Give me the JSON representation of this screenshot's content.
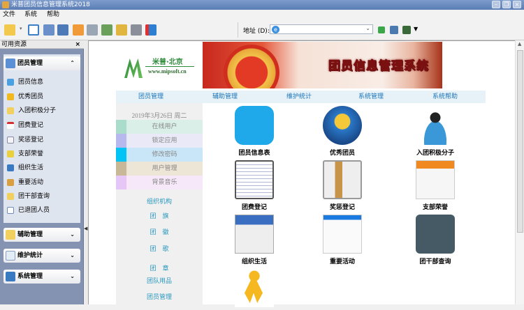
{
  "window": {
    "title": "米普团员信息管理系统2018"
  },
  "menu": [
    "文件",
    "系统",
    "帮助"
  ],
  "address": {
    "label": "地址 (D):",
    "value": ""
  },
  "left_panel": {
    "header": "可用资源",
    "close": "×",
    "groups": [
      {
        "label": "团员管理",
        "expanded": true,
        "items": [
          "团员信息",
          "优秀团员",
          "入团积极分子",
          "团费登记",
          "奖惩登记",
          "支部荣誉",
          "组织生活",
          "重要活动",
          "团干部查询",
          "已退团人员"
        ]
      },
      {
        "label": "辅助管理",
        "expanded": false
      },
      {
        "label": "维护统计",
        "expanded": false
      },
      {
        "label": "系统管理",
        "expanded": false
      }
    ]
  },
  "banner": {
    "logo_cn": "米普·北京",
    "logo_url": "www.mipsoft.cn",
    "title": "团员信息管理系统"
  },
  "nav": [
    "团员管理",
    "辅助管理",
    "维护统计",
    "系统管理",
    "系统帮助"
  ],
  "sidebar": {
    "date": "2019年3月26日  周二",
    "quick": [
      {
        "label": "在线用户",
        "color": "#a9dccb",
        "bg": "#d9efe7"
      },
      {
        "label": "锁定应用",
        "color": "#b7b9ee",
        "bg": "#e9e9f8"
      },
      {
        "label": "修改密码",
        "color": "#00c4f6",
        "bg": "#c8e6f8"
      },
      {
        "label": "用户管理",
        "color": "#c8b898",
        "bg": "#ede5d6"
      },
      {
        "label": "背景音乐",
        "color": "#e6c6f6",
        "bg": "#f6e8f8"
      }
    ],
    "links": [
      "组织机构",
      "团　旗",
      "团　徽",
      "团　歌",
      "团　章",
      "团队用品",
      "团员管理"
    ]
  },
  "apps": [
    "团员信息表",
    "优秀团员",
    "入团积极分子",
    "团费登记",
    "奖惩登记",
    "支部荣誉",
    "组织生活",
    "重要活动",
    "团干部查询",
    ""
  ]
}
